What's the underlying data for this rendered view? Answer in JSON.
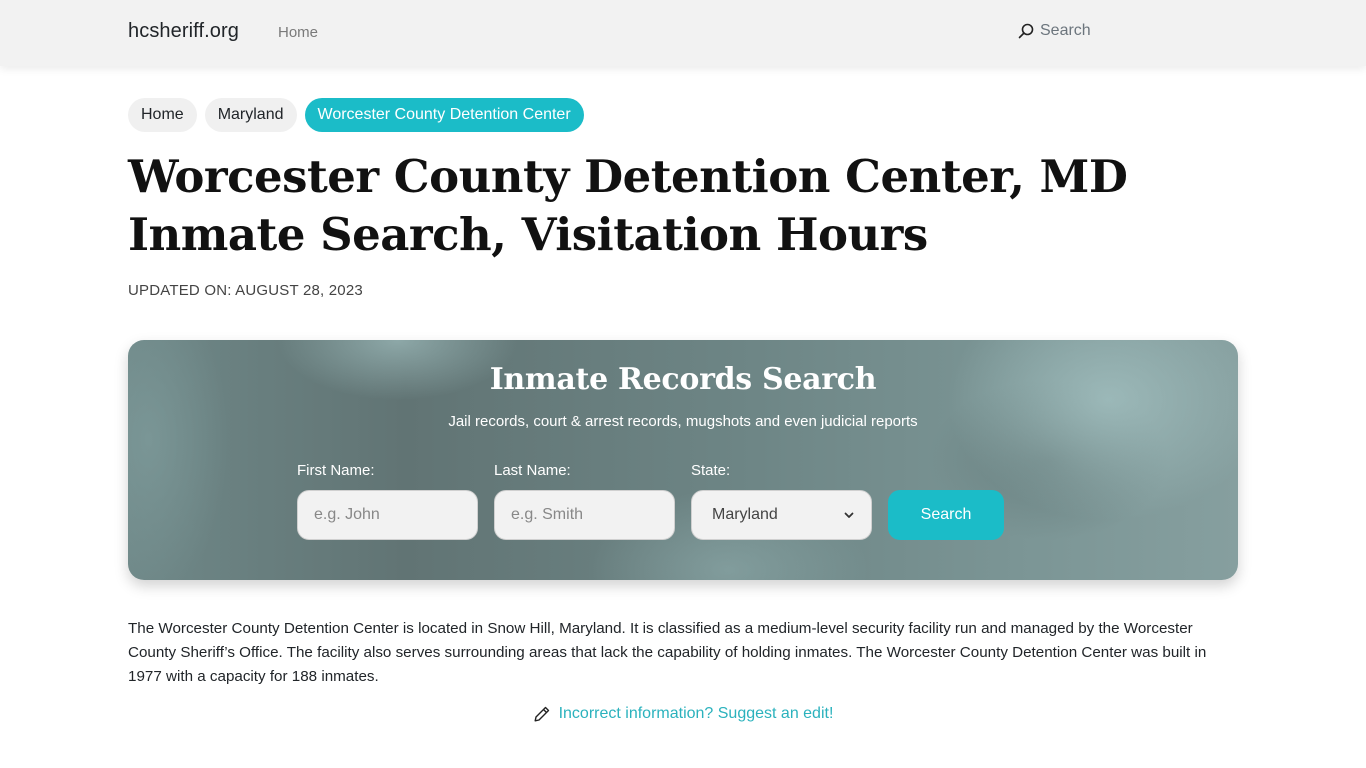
{
  "navbar": {
    "brand": "hcsheriff.org",
    "home_link": "Home",
    "search_label": "Search",
    "search_icon": "search-icon"
  },
  "breadcrumb": [
    {
      "label": "Home",
      "active": false
    },
    {
      "label": "Maryland",
      "active": false
    },
    {
      "label": "Worcester County Detention Center",
      "active": true
    }
  ],
  "page": {
    "title": "Worcester County Detention Center, MD Inmate Search, Visitation Hours",
    "updated": "UPDATED ON: AUGUST 28, 2023"
  },
  "search_card": {
    "title": "Inmate Records Search",
    "subtitle": "Jail records, court & arrest records, mugshots and even judicial reports",
    "first_name": {
      "label": "First Name:",
      "placeholder": "e.g. John",
      "value": ""
    },
    "last_name": {
      "label": "Last Name:",
      "placeholder": "e.g. Smith",
      "value": ""
    },
    "state": {
      "label": "State:",
      "selected": "Maryland",
      "icon": "chevron-down-icon"
    },
    "search_button": "Search"
  },
  "content": {
    "description": "The Worcester County Detention Center is located in Snow Hill, Maryland. It is classified as a medium-level security facility run and managed by the Worcester County Sheriff’s Office. The facility also serves surrounding areas that lack the capability of holding inmates. The Worcester County Detention Center was built in 1977 with a capacity for 188 inmates.",
    "suggest_edit": "Incorrect information? Suggest an edit!",
    "suggest_icon": "pencil-icon"
  },
  "colors": {
    "accent": "#1bbcc8",
    "link": "#2bb2bd",
    "navbar_bg": "#f2f2f2"
  }
}
